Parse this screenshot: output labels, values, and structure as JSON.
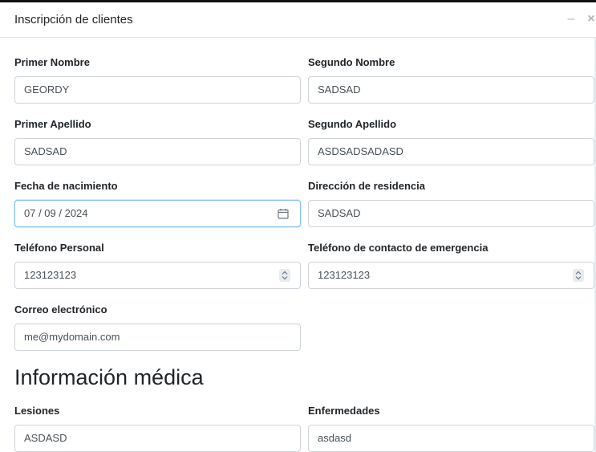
{
  "modal": {
    "title": "Inscripción de clientes",
    "minimize_icon": "minus-icon",
    "close_icon": "close-icon"
  },
  "form": {
    "primer_nombre": {
      "label": "Primer Nombre",
      "value": "GEORDY"
    },
    "segundo_nombre": {
      "label": "Segundo Nombre",
      "value": "SADSAD"
    },
    "primer_apellido": {
      "label": "Primer Apellido",
      "value": "SADSAD"
    },
    "segundo_apellido": {
      "label": "Segundo Apellido",
      "value": "ASDSADSADASD"
    },
    "fecha_nacimiento": {
      "label": "Fecha de nacimiento",
      "value": "07 / 09 / 2024",
      "icon": "calendar-icon"
    },
    "direccion": {
      "label": "Dirección de residencia",
      "value": "SADSAD"
    },
    "telefono_personal": {
      "label": "Teléfono Personal",
      "value": "123123123",
      "icon": "spinner-icon"
    },
    "telefono_emergencia": {
      "label": "Teléfono de contacto de emergencia",
      "value": "123123123",
      "icon": "spinner-icon"
    },
    "correo": {
      "label": "Correo electrónico",
      "value": "me@mydomain.com"
    }
  },
  "medical": {
    "title": "Información médica",
    "lesiones": {
      "label": "Lesiones",
      "value": "ASDASD"
    },
    "enfermedades": {
      "label": "Enfermedades",
      "value": "asdasd"
    }
  }
}
